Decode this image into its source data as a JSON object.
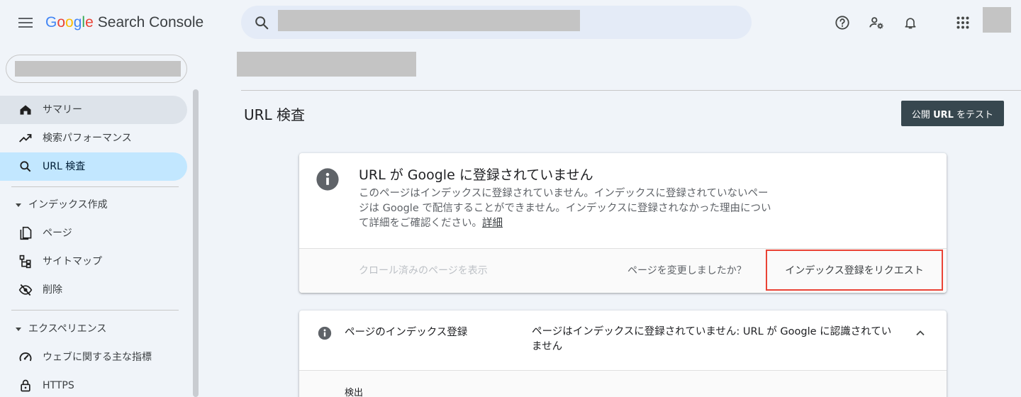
{
  "header": {
    "logo": {
      "g1": "G",
      "o1": "o",
      "o2": "o",
      "g2": "g",
      "l": "l",
      "e": "e",
      "product": "Search Console"
    },
    "icons": [
      "menu-icon",
      "search-icon",
      "help-icon",
      "manage-users-icon",
      "notifications-icon",
      "apps-icon"
    ]
  },
  "sidebar": {
    "items": [
      {
        "label": "サマリー",
        "icon": "home-icon"
      },
      {
        "label": "検索パフォーマンス",
        "icon": "trending-up-icon"
      },
      {
        "label": "URL 検査",
        "icon": "search-icon"
      }
    ],
    "sections": [
      {
        "label": "インデックス作成",
        "items": [
          {
            "label": "ページ",
            "icon": "pages-icon"
          },
          {
            "label": "サイトマップ",
            "icon": "sitemap-icon"
          },
          {
            "label": "削除",
            "icon": "visibility-off-icon"
          }
        ]
      },
      {
        "label": "エクスペリエンス",
        "items": [
          {
            "label": "ウェブに関する主な指標",
            "icon": "speed-icon"
          },
          {
            "label": "HTTPS",
            "icon": "lock-icon"
          }
        ]
      }
    ]
  },
  "main": {
    "title": "URL 検査",
    "test_button": {
      "pre": "公開 ",
      "bold": "URL",
      "post": " をテスト"
    },
    "status_card": {
      "title": "URL が Google に登録されていません",
      "description": "このページはインデックスに登録されていません。インデックスに登録されていないページは Google で配信することができません。インデックスに登録されなかった理由について詳細をご確認ください。",
      "details_link": "詳細",
      "crawl_link": "クロール済みのページを表示",
      "changed_text": "ページを変更しましたか？",
      "request_button": "インデックス登録をリクエスト"
    },
    "index_card": {
      "label": "ページのインデックス登録",
      "value": "ページはインデックスに登録されていません: URL が Google に認識されていません",
      "detection_label": "検出"
    }
  },
  "colors": {
    "accent": "#ea4335",
    "active_nav": "#c2e7ff",
    "test_button": "#37474f"
  }
}
